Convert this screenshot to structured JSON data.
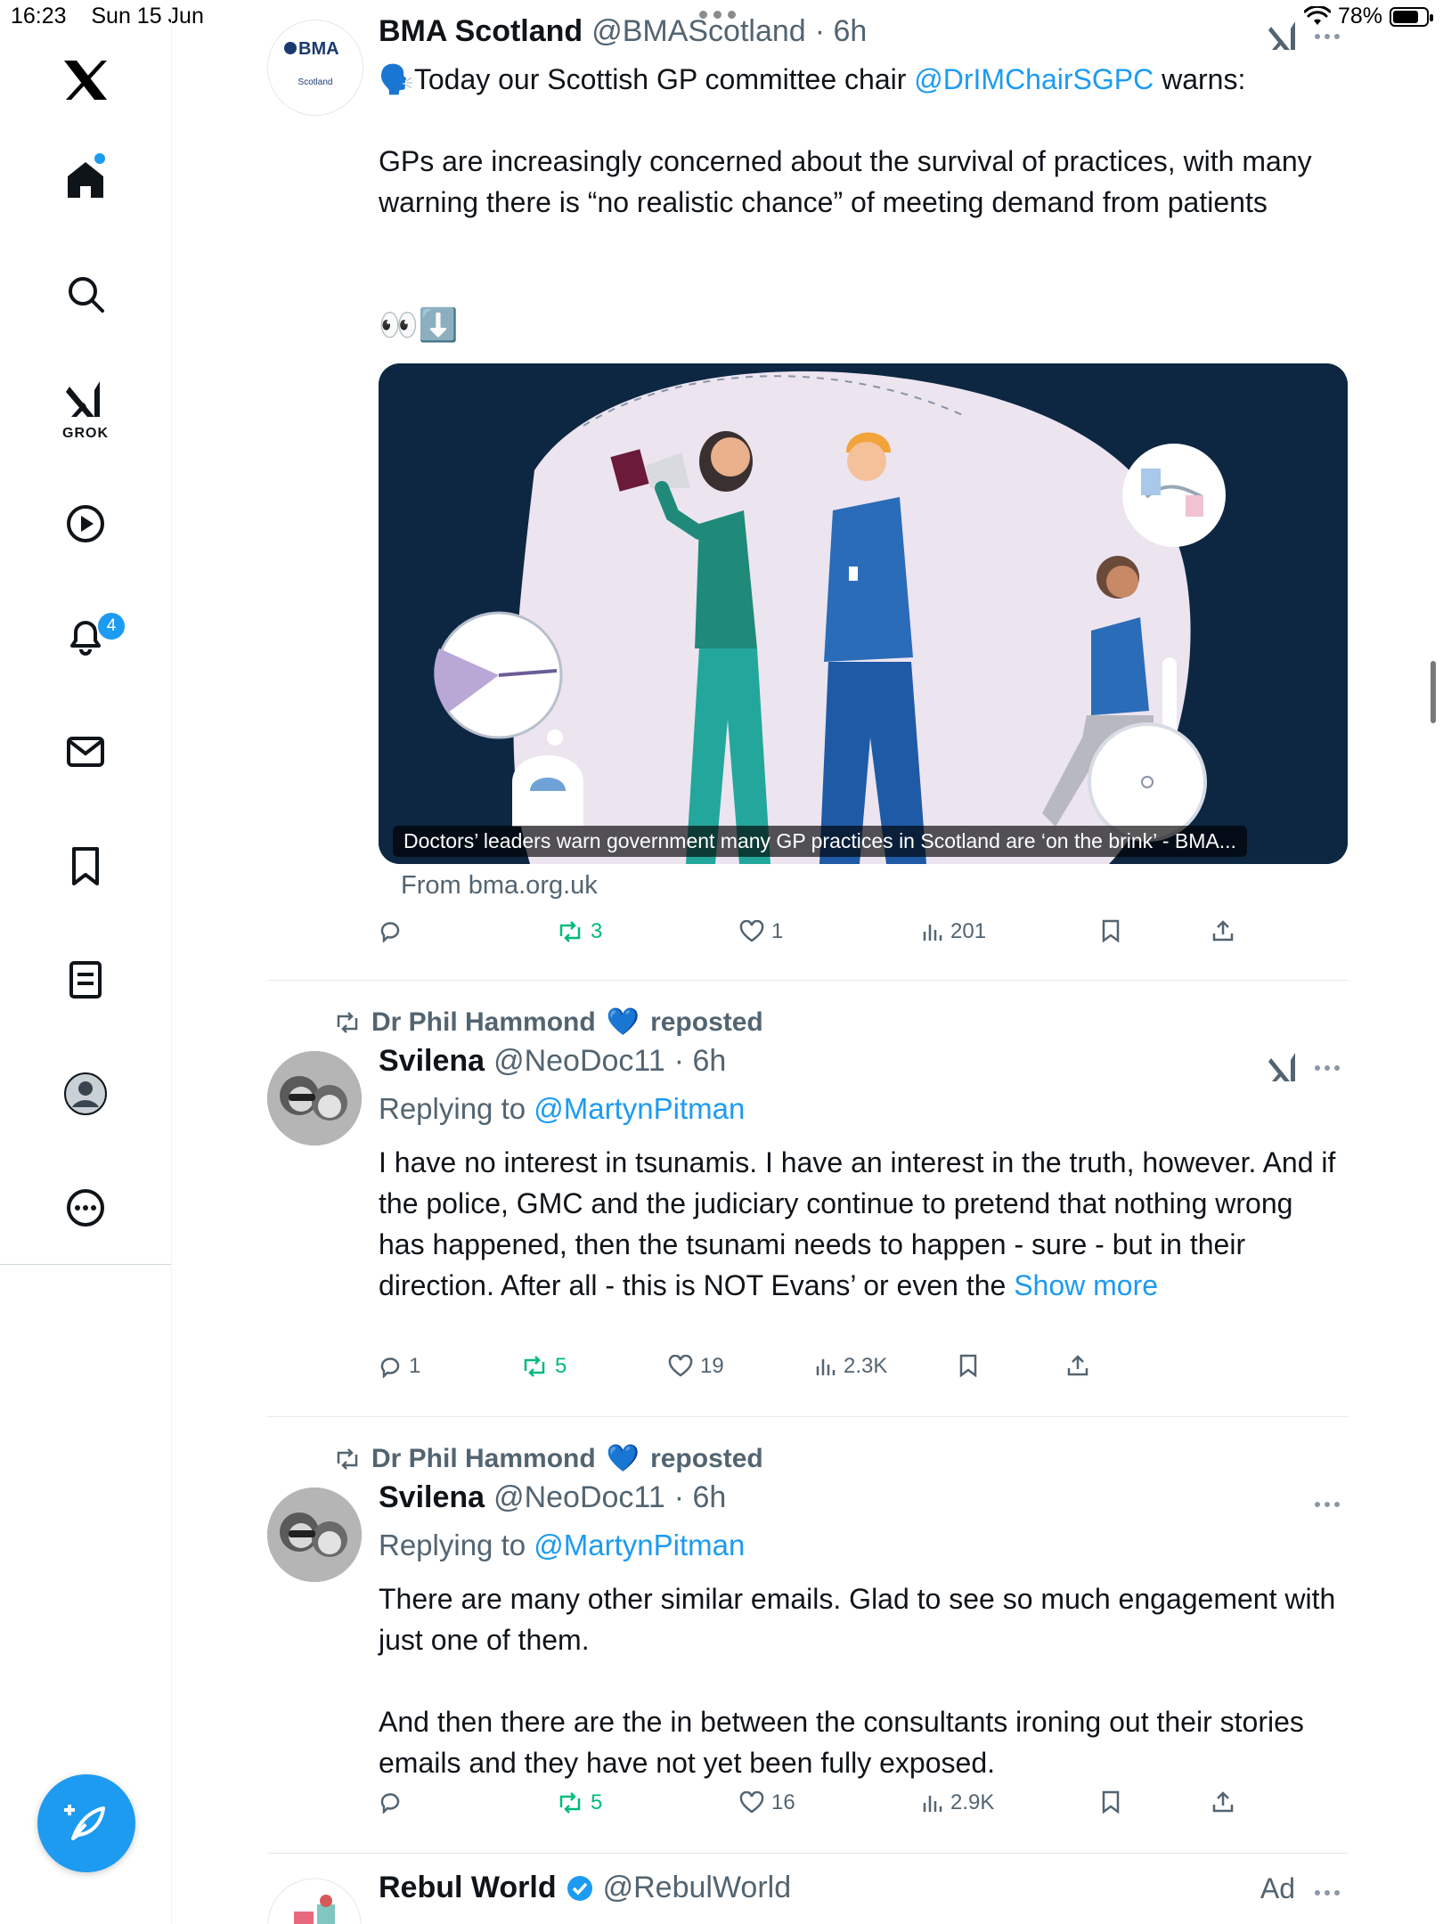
{
  "status_bar": {
    "time": "16:23",
    "date": "Sun 15 Jun",
    "battery": "78%",
    "battery_level": 0.78
  },
  "sidebar": {
    "items": [
      {
        "name": "home",
        "label": ""
      },
      {
        "name": "search",
        "label": ""
      },
      {
        "name": "grok",
        "label": "GROK"
      },
      {
        "name": "video",
        "label": ""
      },
      {
        "name": "notifications",
        "label": "",
        "badge": "4"
      },
      {
        "name": "messages",
        "label": ""
      },
      {
        "name": "bookmarks",
        "label": ""
      },
      {
        "name": "lists",
        "label": ""
      },
      {
        "name": "profile",
        "label": ""
      },
      {
        "name": "more",
        "label": ""
      }
    ]
  },
  "posts": [
    {
      "avatar": {
        "brand": "BMA",
        "sub": "Scotland"
      },
      "name": "BMA Scotland",
      "handle": "@BMAScotland",
      "time": "· 6h",
      "text_intro": "🗣️Today our Scottish GP committee chair ",
      "mention": "@DrIMChairSGPC",
      "text_after": " warns:",
      "text_body": "GPs are increasingly concerned about the survival of practices, with many warning there is “no realistic chance” of meeting demand from patients",
      "emoji_line": "👀⬇️",
      "card_caption": "Doctors’ leaders warn government many GP practices in Scotland are ‘on the brink’ - BMA...",
      "card_from": "From bma.org.uk",
      "stats": {
        "replies": "",
        "reposts": "3",
        "likes": "1",
        "views": "201"
      }
    },
    {
      "reposter": "Dr Phil Hammond",
      "reposter_emoji": "💙",
      "reposted_label": "reposted",
      "name": "Svilena",
      "handle": "@NeoDoc11",
      "time": "· 6h",
      "replying_label": "Replying to ",
      "replying_to": "@MartynPitman",
      "text": "I have no interest in tsunamis. I have an interest in the truth, however. And if the police, GMC and the judiciary continue to pretend that nothing wrong has happened, then the tsunami needs to happen - sure - but in their direction. After all - this is NOT Evans’ or even the ",
      "show_more": "Show more",
      "stats": {
        "replies": "1",
        "reposts": "5",
        "likes": "19",
        "views": "2.3K"
      }
    },
    {
      "reposter": "Dr Phil Hammond",
      "reposter_emoji": "💙",
      "reposted_label": "reposted",
      "name": "Svilena",
      "handle": "@NeoDoc11",
      "time": "· 6h",
      "replying_label": "Replying to ",
      "replying_to": "@MartynPitman",
      "text": "There are many other similar emails. Glad to see so much engagement with just one of them.\n\nAnd then there are the in between the consultants ironing out their stories emails and they have not yet been fully exposed.",
      "stats": {
        "replies": "",
        "reposts": "5",
        "likes": "16",
        "views": "2.9K"
      }
    },
    {
      "name": "Rebul World",
      "handle": "@RebulWorld",
      "ad_label": "Ad"
    }
  ],
  "colors": {
    "accent": "#1d9bf0",
    "repost": "#00ba7c",
    "muted": "#536471",
    "card_bg": "#0d2742"
  }
}
